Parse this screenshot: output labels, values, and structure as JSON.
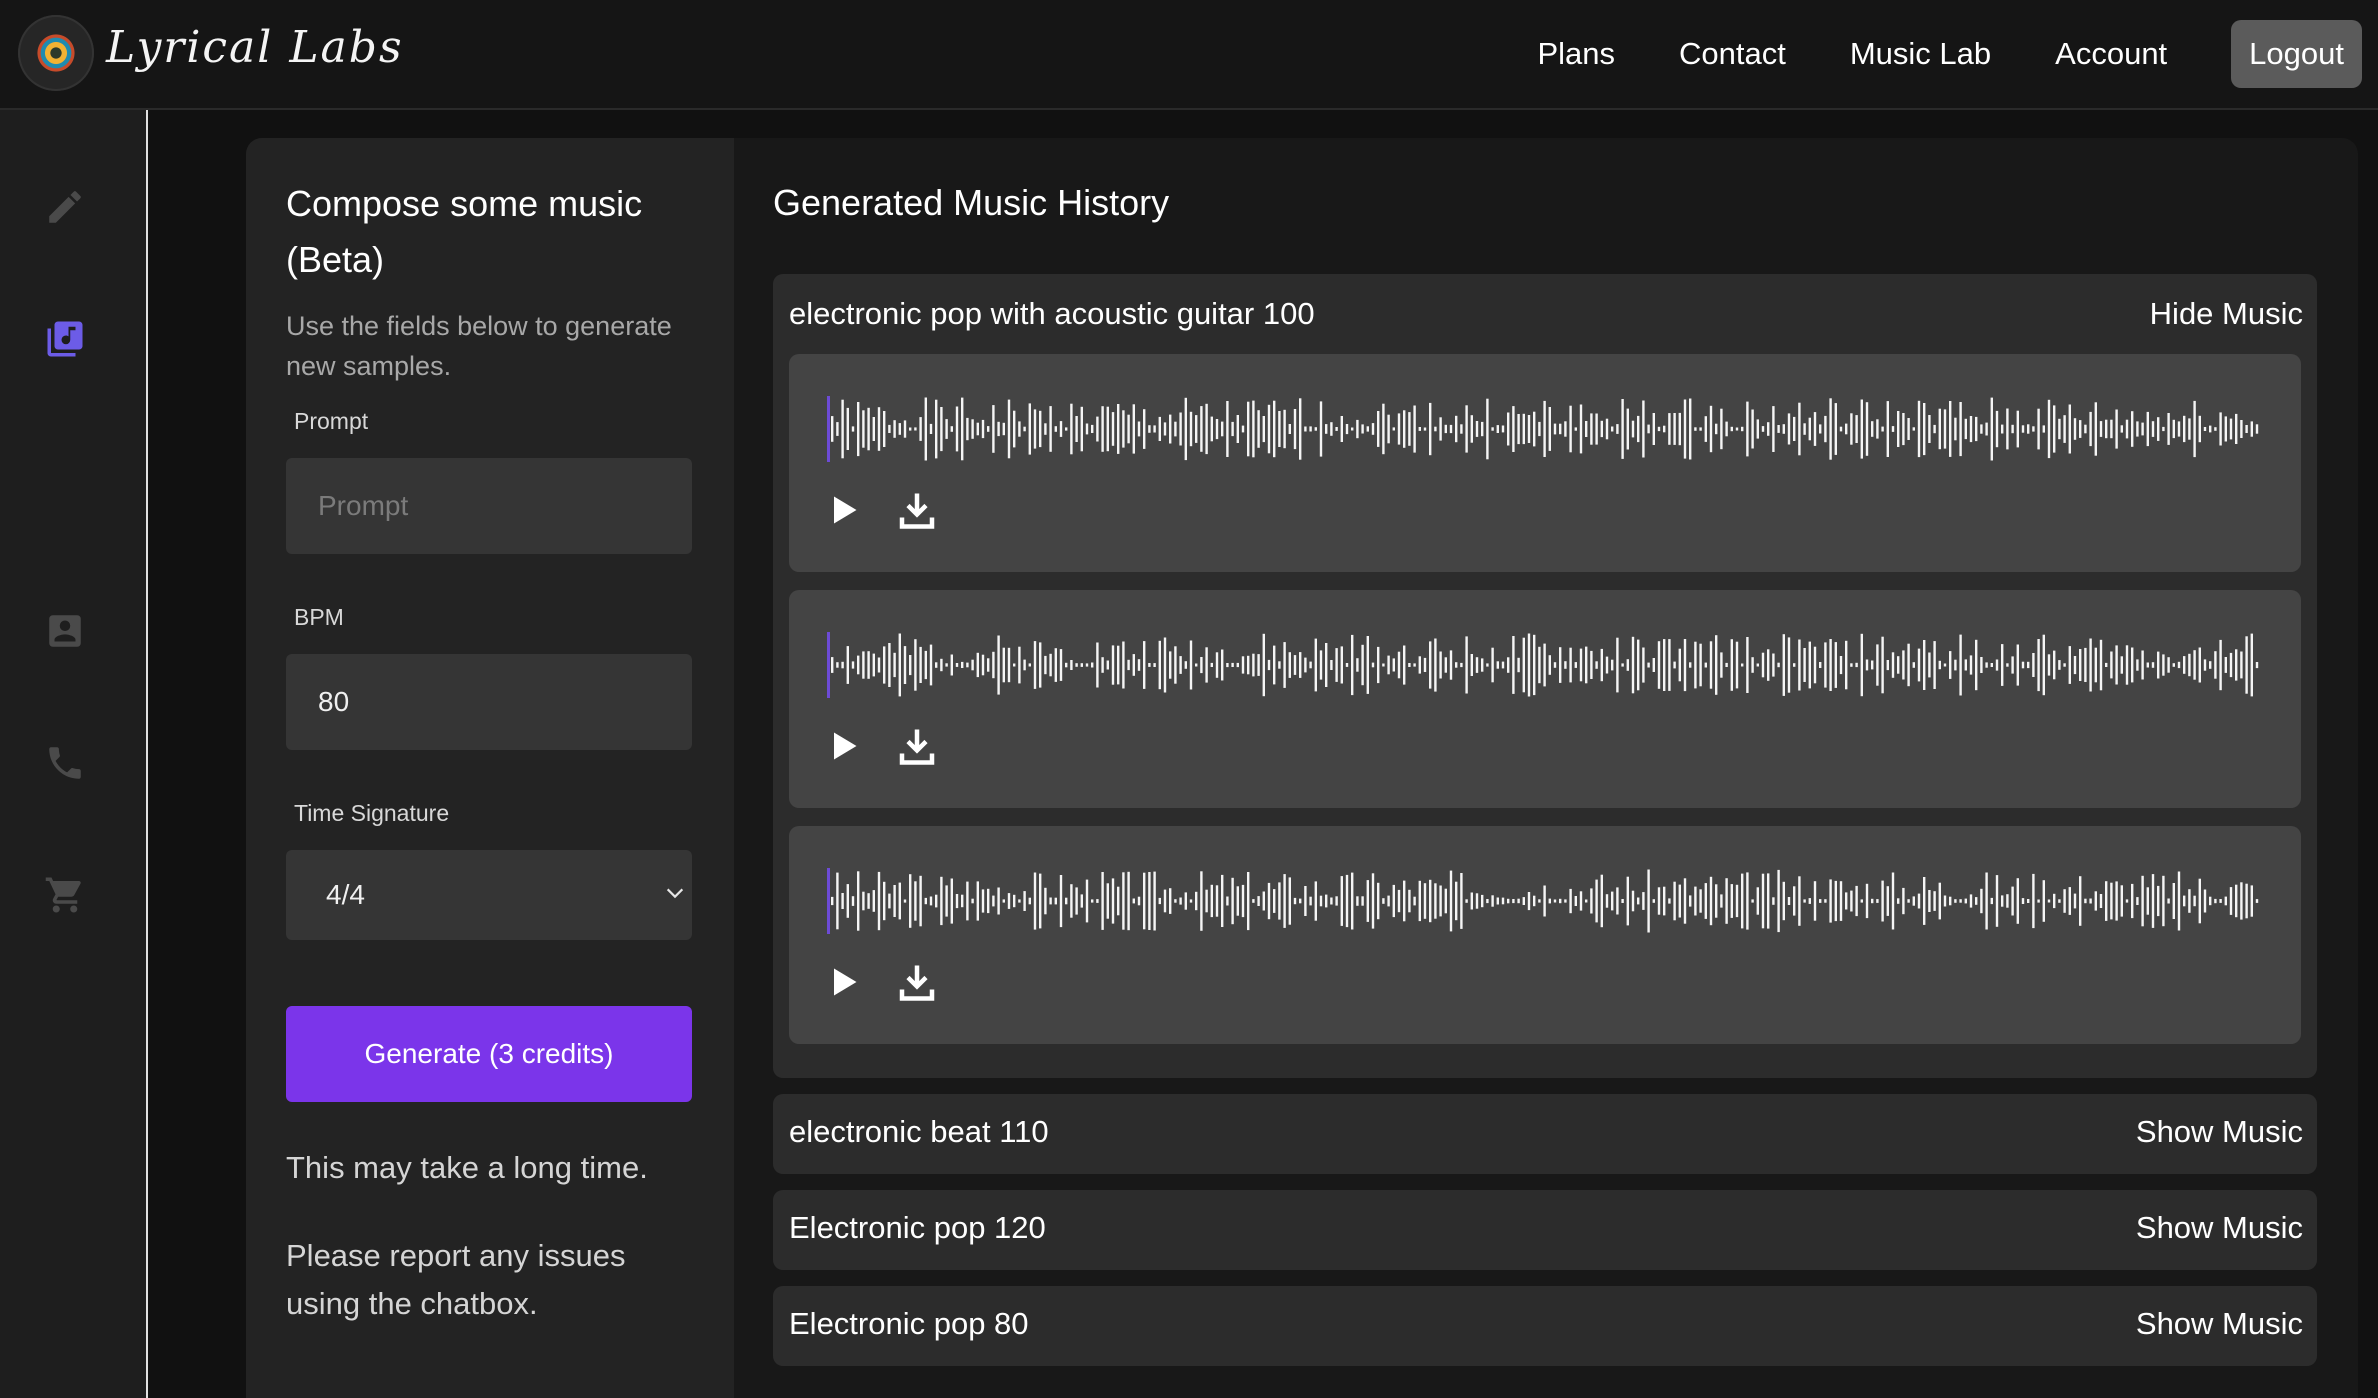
{
  "header": {
    "logo_text": "Lyrical Labs",
    "nav": [
      "Plans",
      "Contact",
      "Music Lab",
      "Account"
    ],
    "logout_label": "Logout"
  },
  "sidebar": {
    "icons": [
      "pencil-icon",
      "music-library-icon",
      "contact-card-icon",
      "phone-icon",
      "cart-icon"
    ],
    "active_index": 1,
    "accent_color": "#6c5ce7"
  },
  "form": {
    "title": "Compose some music (Beta)",
    "subtitle": "Use the fields below to generate new samples.",
    "prompt_label": "Prompt",
    "prompt_placeholder": "Prompt",
    "prompt_value": "",
    "bpm_label": "BPM",
    "bpm_value": "80",
    "time_signature_label": "Time Signature",
    "time_signature_value": "4/4",
    "generate_label": "Generate (3 credits)",
    "note_1": "This may take a long time.",
    "note_2": "Please report any issues using the chatbox.",
    "button_color": "#7b35ea"
  },
  "history": {
    "title": "Generated Music History",
    "groups": [
      {
        "title": "electronic pop with acoustic guitar 100",
        "toggle": "Hide Music",
        "expanded": true,
        "track_count": 3
      },
      {
        "title": "electronic beat 110",
        "toggle": "Show Music",
        "expanded": false
      },
      {
        "title": "Electronic pop 120",
        "toggle": "Show Music",
        "expanded": false
      },
      {
        "title": "Electronic pop 80",
        "toggle": "Show Music",
        "expanded": false
      }
    ]
  }
}
